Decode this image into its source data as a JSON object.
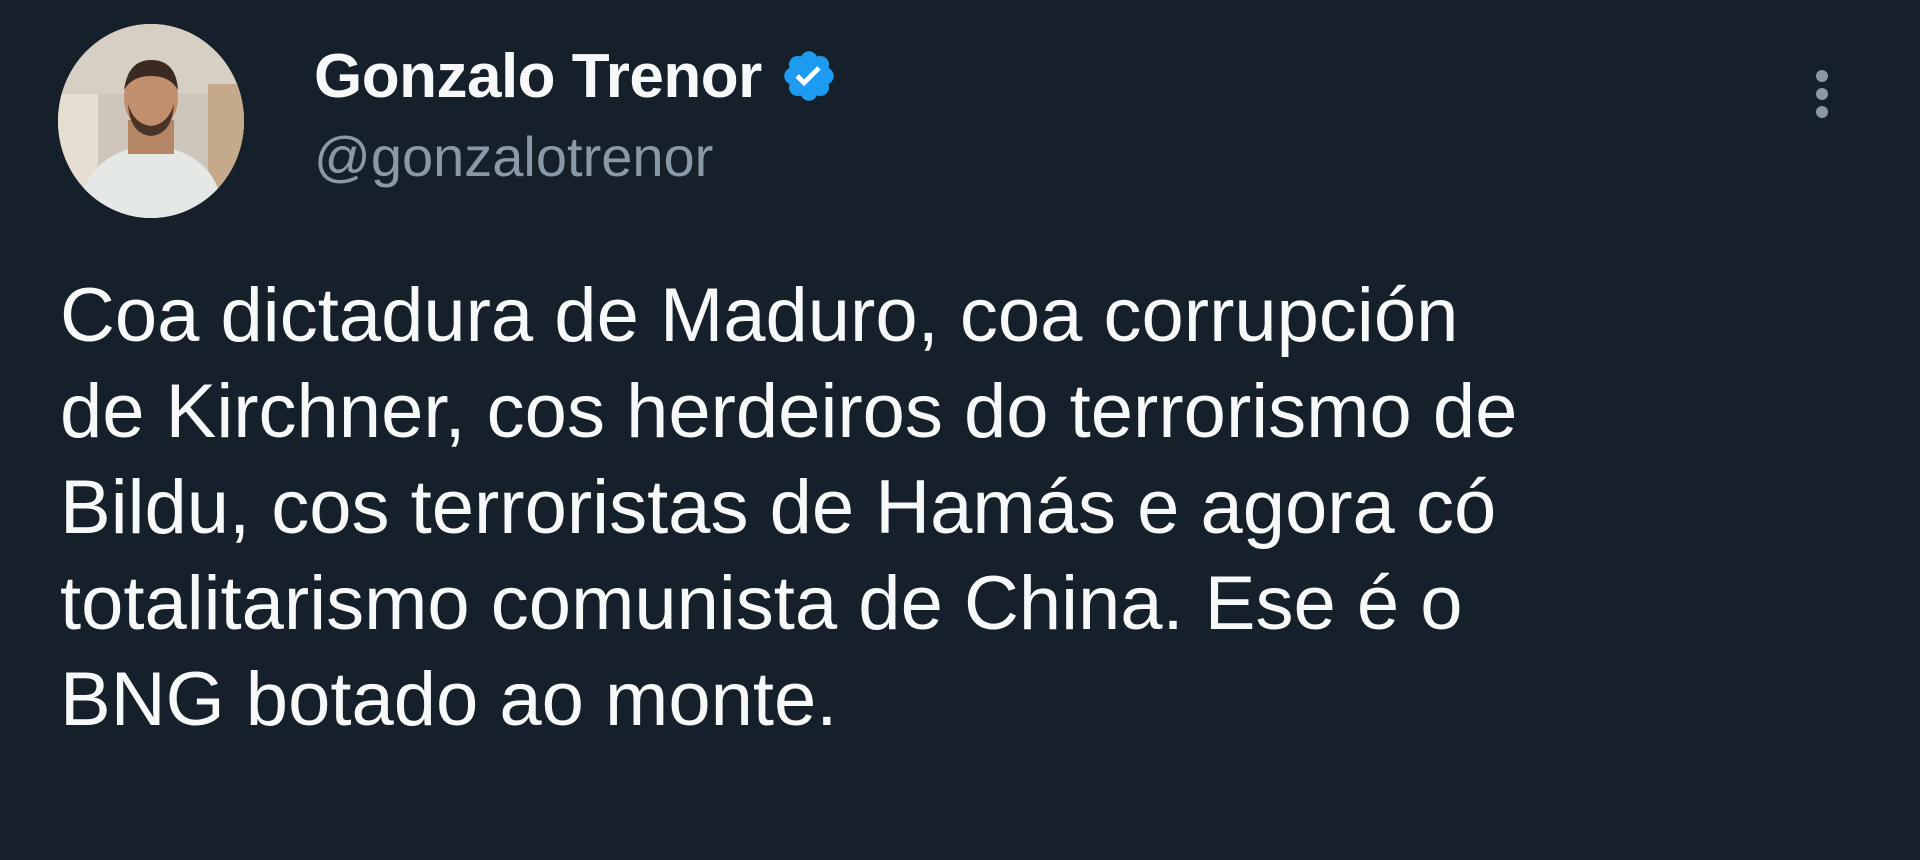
{
  "author": {
    "display_name": "Gonzalo Trenor",
    "handle": "@gonzalotrenor",
    "verified": true,
    "verified_color": "#1d9bf0"
  },
  "tweet": {
    "text_lines": [
      "Coa dictadura de Maduro, coa corrupción",
      "de Kirchner, cos herdeiros do terrorismo de",
      "Bildu, cos terroristas de Hamás e agora có",
      "totalitarismo comunista de China. Ese é o",
      "BNG botado ao monte."
    ]
  },
  "icons": {
    "avatar": "profile-photo",
    "verified": "verified-badge-icon",
    "more": "more-vertical-icon"
  },
  "colors": {
    "background": "#15202b",
    "text_primary": "#f7f9f9",
    "text_secondary": "#8b98a5"
  }
}
